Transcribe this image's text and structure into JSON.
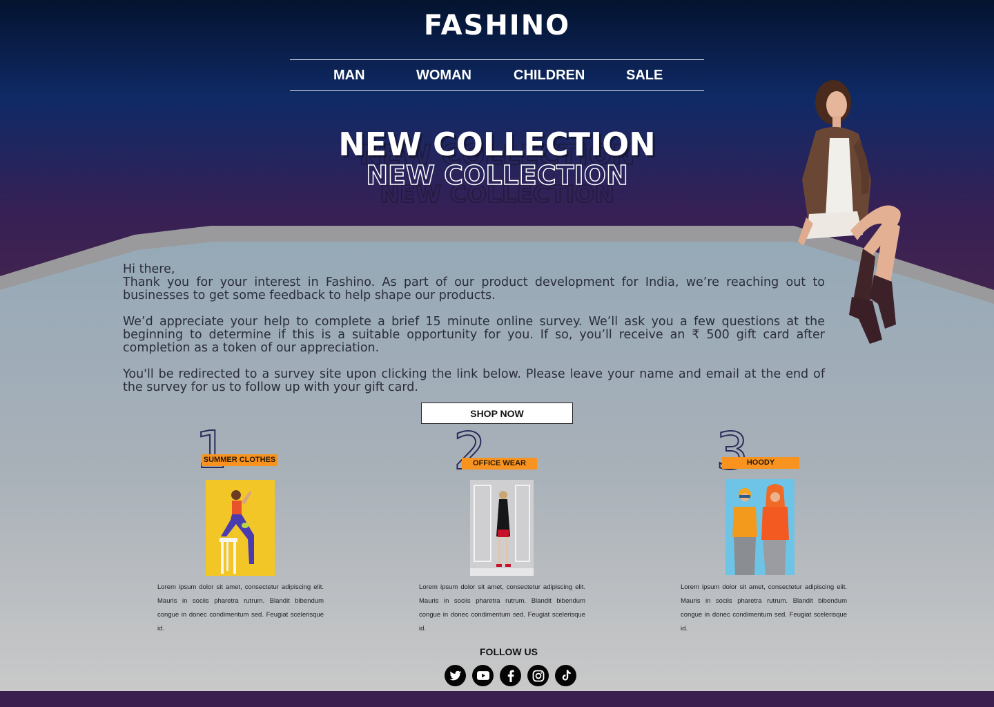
{
  "brand": {
    "logo": "FASHINO"
  },
  "nav": {
    "items": [
      "MAN",
      "WOMAN",
      "CHILDREN",
      "SALE"
    ]
  },
  "hero": {
    "title": "NEW COLLECTION"
  },
  "intro": {
    "paragraphs": [
      "Hi there,\nThank you for your interest in Fashino. As part of our product development for India, we’re reaching out to businesses to get some feedback to help shape our products.",
      "We’d appreciate your help to complete a brief 15 minute online survey. We’ll ask you a few questions at the beginning to determine if this is a suitable opportunity for you. If so, you’ll receive an ₹ 500 gift card after completion as a token of our appreciation.",
      "You'll be redirected to a survey site upon clicking the link below. Please leave your name and email at the end of the survey for us to follow up with your gift card."
    ]
  },
  "cta": {
    "label": "SHOP NOW"
  },
  "cards": [
    {
      "number": "1",
      "tag": "SUMMER CLOTHES",
      "description": "Lorem ipsum dolor sit amet, consectetur adipiscing elit. Mauris in sociis pharetra rutrum. Blandit bibendum congue in donec condimentum sed. Feugiat scelerisque id."
    },
    {
      "number": "2",
      "tag": "OFFICE WEAR",
      "description": "Lorem ipsum dolor sit amet, consectetur adipiscing elit. Mauris in sociis pharetra rutrum. Blandit bibendum congue in donec condimentum sed. Feugiat scelerisque id."
    },
    {
      "number": "3",
      "tag": "HOODY",
      "description": "Lorem ipsum dolor sit amet, consectetur adipiscing elit. Mauris in sociis pharetra rutrum. Blandit bibendum congue in donec condimentum sed. Feugiat scelerisque id."
    }
  ],
  "footer": {
    "follow_label": "FOLLOW US",
    "social_icons": [
      "twitter-icon",
      "youtube-icon",
      "facebook-icon",
      "instagram-icon",
      "tiktok-icon"
    ]
  },
  "colors": {
    "accent_tag": "#f7931e",
    "header_top": "#04132f",
    "header_purple": "#43244f",
    "panel": "#a1acb7"
  }
}
